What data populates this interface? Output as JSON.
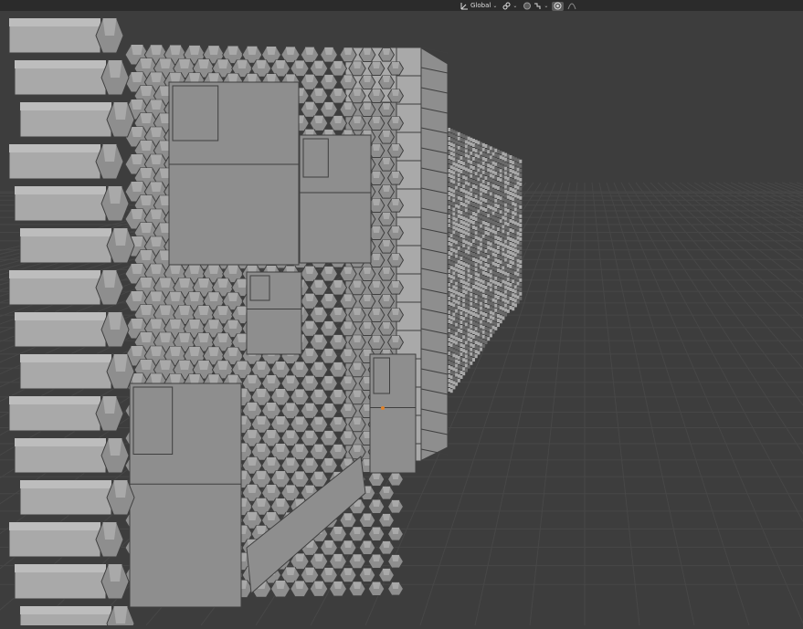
{
  "header": {
    "transform_orientation": "Global",
    "icons": [
      "transform-orientation-icon",
      "link-icon",
      "proportional-editing-icon",
      "snap-icon",
      "overlay-dot-icon",
      "curve-icon"
    ]
  },
  "colors": {
    "viewport_bg": "#3d3d3d",
    "grid": "#474747",
    "header_bg": "#2b2b2b",
    "face_light": "#a9a9a9",
    "face_mid": "#8e8e8e",
    "face_dark": "#6a6a6a",
    "edge": "#3f3f3f",
    "origin": "#e0822a"
  }
}
